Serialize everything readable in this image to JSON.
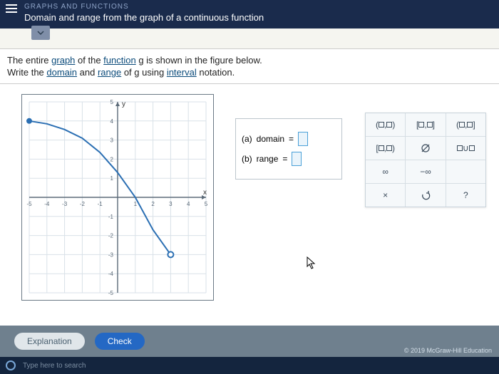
{
  "header": {
    "section": "GRAPHS AND FUNCTIONS",
    "title": "Domain and range from the graph of a continuous function"
  },
  "instructions": {
    "line1a": "The entire ",
    "line1b": "graph",
    "line1c": " of the ",
    "line1d": "function",
    "line1e": " g is shown in the figure below.",
    "line2a": "Write the ",
    "line2b": "domain",
    "line2c": " and ",
    "line2d": "range",
    "line2e": " of g using ",
    "line2f": "interval",
    "line2g": " notation."
  },
  "axes": {
    "ylabel": "y",
    "xlabel": "x"
  },
  "answers": {
    "a_label": "(a)",
    "a_text": "domain",
    "b_label": "(b)",
    "b_text": "range",
    "eq": "="
  },
  "keypad": {
    "open_open": "(□,□)",
    "closed_closed": "[□,□]",
    "open_closed": "(□,□]",
    "closed_open": "[□,□)",
    "empty_set": "∅",
    "union": "□∪□",
    "inf": "∞",
    "neg_inf": "−∞",
    "clear": "×",
    "undo": "↶",
    "help": "?"
  },
  "buttons": {
    "explanation": "Explanation",
    "check": "Check"
  },
  "footer": {
    "copyright": "© 2019 McGraw-Hill Education"
  },
  "taskbar": {
    "search": "Type here to search"
  },
  "chart_data": {
    "type": "line",
    "title": "",
    "xlabel": "x",
    "ylabel": "y",
    "xlim": [
      -5,
      5
    ],
    "ylim": [
      -5,
      5
    ],
    "series": [
      {
        "name": "g",
        "points": [
          {
            "x": -5,
            "y": 4,
            "endpoint": "closed"
          },
          {
            "x": -4,
            "y": 3.85
          },
          {
            "x": -3,
            "y": 3.55
          },
          {
            "x": -2,
            "y": 3.1
          },
          {
            "x": -1,
            "y": 2.35
          },
          {
            "x": 0,
            "y": 1.3
          },
          {
            "x": 1,
            "y": 0
          },
          {
            "x": 2,
            "y": -1.7
          },
          {
            "x": 3,
            "y": -3,
            "endpoint": "open"
          }
        ]
      }
    ]
  }
}
